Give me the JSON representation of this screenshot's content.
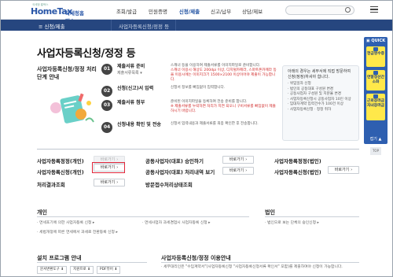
{
  "header": {
    "logo_main": "HomeTax",
    "logo_sub": "국세청홈택스",
    "logo_tag": "국세청 홈택스",
    "nav": [
      "조회/발급",
      "민원증명",
      "신청/제출",
      "신고/납부",
      "상담/제보"
    ],
    "active_nav": 2
  },
  "subnav": {
    "menu_label": "≡  신청/제출",
    "breadcrumb": "사업자등록신청/정정 등"
  },
  "quick": {
    "title": "▣ QUICK",
    "items": [
      "현금영수증",
      "연말정산간소화",
      "근로장려금자녀장려금"
    ],
    "more": "접기 ▲",
    "top": "TOP"
  },
  "page": {
    "title": "사업자등록신청/정정 등",
    "subtitle": "사업자등록신청/정정 처리단계 안내"
  },
  "steps": [
    {
      "num": "01",
      "title": "제출서류 준비",
      "sub": "제출서류목록 ▾",
      "desc": "스캐너 등을 이용하여 제출서류를 이미지파일로 준비합니다.",
      "desc2": "스캐너 이용시 해상도 200dpi 이상, 디지털카메라, 스마트폰카메라 등을 이용시에는 이미지크기 1500×2100 이상이어야 제출이 가능합니다.",
      "red": true
    },
    {
      "num": "02",
      "title": "신청(신고)서 입력",
      "sub": "",
      "desc": "신청서 정보를 빠짐없이 입력합니다.",
      "desc2": "",
      "red": false
    },
    {
      "num": "03",
      "title": "제출서류 첨부",
      "sub": "",
      "desc": "준비된 이미지파일을 등록하여 전송 준비를 합니다.",
      "desc2": "※ 제출서류를 누락하면 처리가 지연 되오니 구비서류를 빠짐없이 제출하시기 바랍니다.",
      "red": true
    },
    {
      "num": "04",
      "title": "신청내용 확인 및 전송",
      "sub": "",
      "desc": "신청서 입력내용과 제출서류를 최종 확인한 후 전송합니다.",
      "desc2": "",
      "red": false
    }
  ],
  "infobox": {
    "heading": "아래의 경우는 세무서에 직접 방문하여 신청(정정)하셔야 합니다.",
    "items": [
      "· 위임일자 신청",
      "· 법인의 공동대표 구성원 변경",
      "· 공동사업자 구성원 및 지분율 변경",
      "· 사업자등록신청시 공동사업자 10인 이상",
      "· 임대차계약 입력건수가 100건 이상",
      "· 사업자등록신청 · 정정 취하"
    ]
  },
  "shortcuts": {
    "button_label": "바로가기",
    "rows": [
      {
        "label": "사업자등록정정(개인)",
        "disabled": true
      },
      {
        "label": "사업자등록신청(개인)",
        "disabled": false
      },
      {
        "label": "처리결과조회",
        "disabled": false
      }
    ],
    "mid": [
      {
        "label": "공동사업자(대표) 승인하기"
      },
      {
        "label": "공동사업자(대표) 처리내역 보기"
      },
      {
        "label": "방문접수처리상태조회"
      }
    ],
    "right": [
      {
        "label": "사업자등록정정(법인)",
        "disabled": true
      },
      {
        "label": "사업자등록신청(법인)",
        "disabled": false
      }
    ]
  },
  "sections": {
    "personal": {
      "title": "개인",
      "items": [
        "· 면세포기에 의한 사업자등록 신청 ▸",
        "· 면세사업자 과세겸업시 사업자등록 신청 ▸",
        "· 세법개정에 따른 면세에서 과세로 전환등록 신청 ▸"
      ]
    },
    "corporate": {
      "title": "법인",
      "items": [
        "· 법인으로 보는 단체의 승인신청 ▸"
      ]
    },
    "install": {
      "title": "설치 프로그램 안내",
      "buttons": [
        "문서변환도구 ⬇",
        "지원프로 ⬇",
        "PDF뷰어 ⬇"
      ]
    },
    "guide": {
      "title": "사업자등록신청/정정 이용안내",
      "items": [
        "· 세무대리인은 \"수임계약서\"(사업자등록신청 \"사업자등록신청서류 확인서\" 포함)를 제출하여야 신청이 가능합니다."
      ]
    }
  }
}
